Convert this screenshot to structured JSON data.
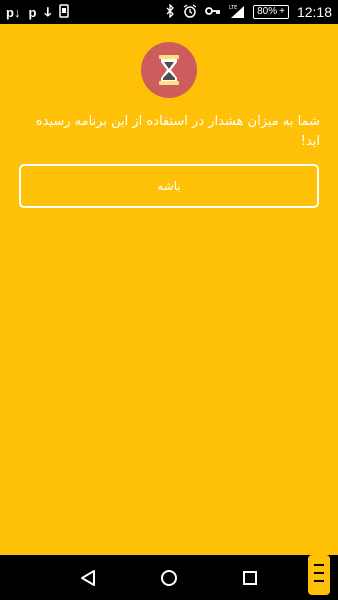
{
  "status_bar": {
    "notifications": [
      "p↓",
      "p",
      "ↆ"
    ],
    "battery": "80%",
    "clock": "12:18",
    "icons": [
      "bluetooth-icon",
      "alarm-icon",
      "vpn-key-icon",
      "lte-signal-icon",
      "battery-icon"
    ]
  },
  "app": {
    "icon": "hourglass-icon",
    "warning_text": "شما به میزان هشدار در استفاده از این برنامه رسیده اید!",
    "ok_button_label": "باشه",
    "accent_color": "#FFC107",
    "icon_bg_color": "#CD5C5C"
  },
  "nav_bar": {
    "buttons": [
      "back-icon",
      "home-icon",
      "recents-icon"
    ]
  }
}
